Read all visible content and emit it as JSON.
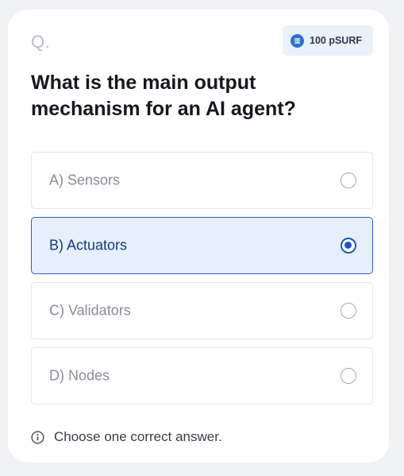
{
  "header": {
    "question_marker": "Q.",
    "reward": {
      "icon": "coin-icon",
      "label": "100 pSURF"
    }
  },
  "question": {
    "text": "What is the main output mechanism for an AI agent?"
  },
  "options": [
    {
      "label": "A) Sensors",
      "selected": false
    },
    {
      "label": "B) Actuators",
      "selected": true
    },
    {
      "label": "C) Validators",
      "selected": false
    },
    {
      "label": "D) Nodes",
      "selected": false
    }
  ],
  "hint": {
    "icon": "info-icon",
    "text": "Choose one correct answer."
  },
  "colors": {
    "accent": "#1f55c4",
    "selected_background": "#e6effc",
    "reward_background": "#e9f1fb"
  }
}
